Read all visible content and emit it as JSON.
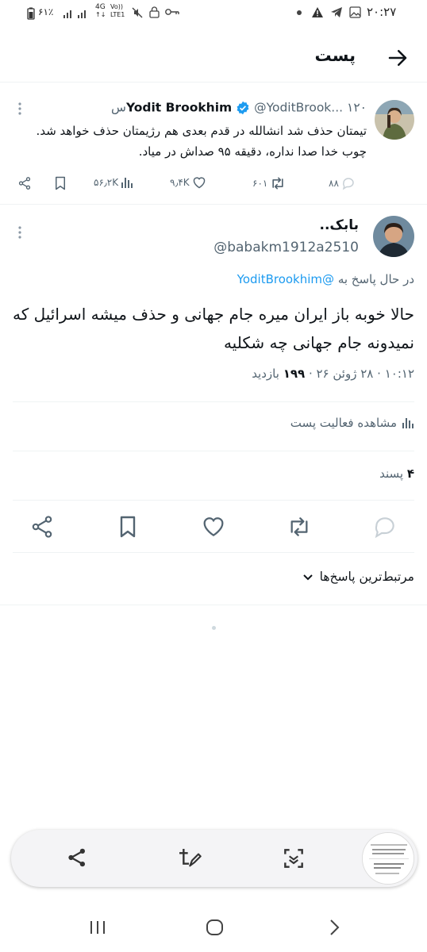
{
  "status_bar": {
    "time": "۲۰:۲۷",
    "battery": "۶۱٪",
    "network_type": "4G",
    "network_sub": "LTE1",
    "volte": "Vo))"
  },
  "header": {
    "title": "پست"
  },
  "original_tweet": {
    "display_name": "Yodit Brookhim",
    "handle": "@YoditBrook...",
    "time": "۱۲۰س",
    "text": "تیمتان حذف شد انشالله در قدم بعدی هم رژیمتان حذف خواهد شد. چوب خدا صدا نداره، دقیقه ۹۵ صداش در میاد.",
    "reply_count": "۸۸",
    "retweet_count": "۶۰۱",
    "like_count": "۹٫۴K",
    "view_count": "۵۶٫۲K"
  },
  "reply_tweet": {
    "display_name": "بابک..",
    "handle": "@babakm1912a2510",
    "replying_to_prefix": "در حال پاسخ به",
    "replying_to_handle": "@YoditBrookhim",
    "text": "حالا خوبه باز ایران میره جام جهانی و حذف میشه اسرائیل که نمیدونه جام جهانی چه شکلیه",
    "time": "۱۰:۱۲",
    "date": "۲۸ ژوئن ۲۶",
    "separator": "·",
    "views_count": "۱۹۹",
    "views_label": "بازدید",
    "view_activity_label": "مشاهده فعالیت پست",
    "likes_count": "۴",
    "likes_label": "پسند",
    "sort_label": "مرتبط‌ترین پاسخ‌ها"
  },
  "colors": {
    "accent": "#1d9bf0",
    "text": "#0f1419",
    "secondary_text": "#536471",
    "divider": "#eff3f4",
    "verified_badge": "#1d9bf0"
  },
  "icons": {
    "back": "arrow-right-icon",
    "verified": "verified-badge-icon",
    "more": "more-vertical-icon",
    "reply": "comment-icon",
    "retweet": "retweet-icon",
    "like": "heart-icon",
    "views": "bar-chart-icon",
    "bookmark": "bookmark-icon",
    "share": "share-icon",
    "dropdown": "chevron-down-icon"
  }
}
